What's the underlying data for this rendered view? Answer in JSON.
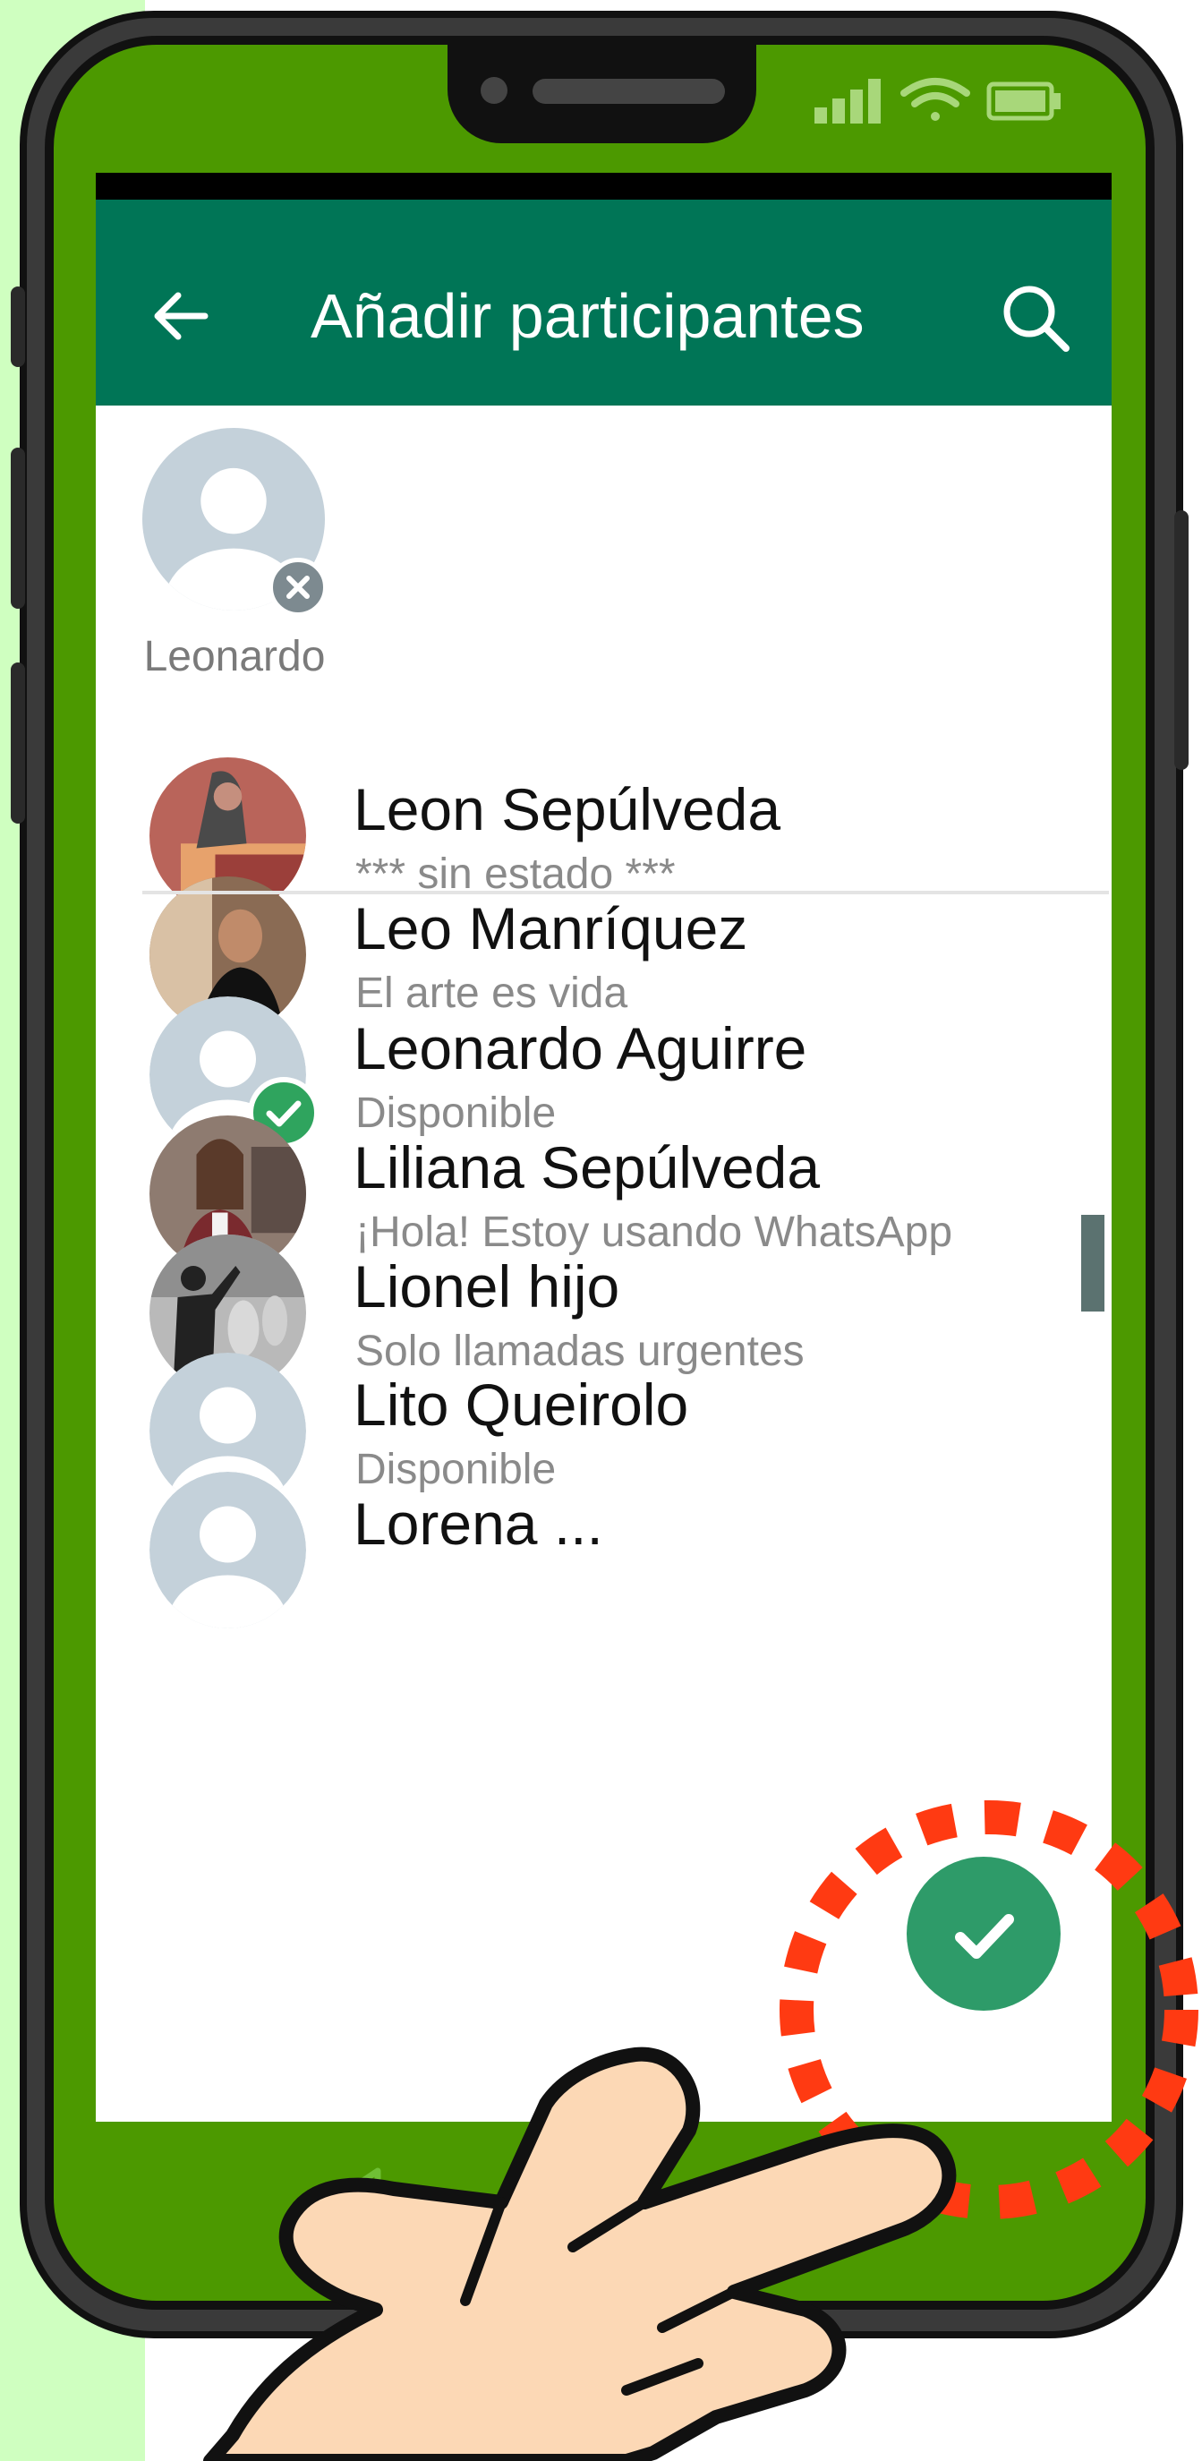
{
  "header": {
    "title": "Añadir participantes",
    "back_icon": "arrow-left-icon",
    "search_icon": "search-icon"
  },
  "selected": [
    {
      "name": "Leonardo",
      "remove_icon": "close-icon"
    }
  ],
  "contacts": [
    {
      "name": "Leon Sepúlveda",
      "status": "*** sin estado ***",
      "avatar": "photo",
      "selected": false
    },
    {
      "name": "Leo Manríquez",
      "status": "El arte es vida",
      "avatar": "photo",
      "selected": false
    },
    {
      "name": "Leonardo Aguirre",
      "status": "Disponible",
      "avatar": "default",
      "selected": true
    },
    {
      "name": "Liliana Sepúlveda",
      "status": "¡Hola! Estoy usando WhatsApp",
      "avatar": "photo",
      "selected": false
    },
    {
      "name": "Lionel hijo",
      "status": "Solo llamadas urgentes",
      "avatar": "photo",
      "selected": false
    },
    {
      "name": "Lito Queirolo",
      "status": "Disponible",
      "avatar": "default",
      "selected": false
    },
    {
      "name": "Lorena ...",
      "status": "",
      "avatar": "default",
      "selected": false
    }
  ],
  "fab": {
    "icon": "checkmark-icon"
  },
  "colors": {
    "header": "#007556",
    "phone_body": "#4c9900",
    "accent_check": "#2fa45e",
    "fab": "#2e9b69",
    "highlight_ring": "#ff3a12"
  }
}
